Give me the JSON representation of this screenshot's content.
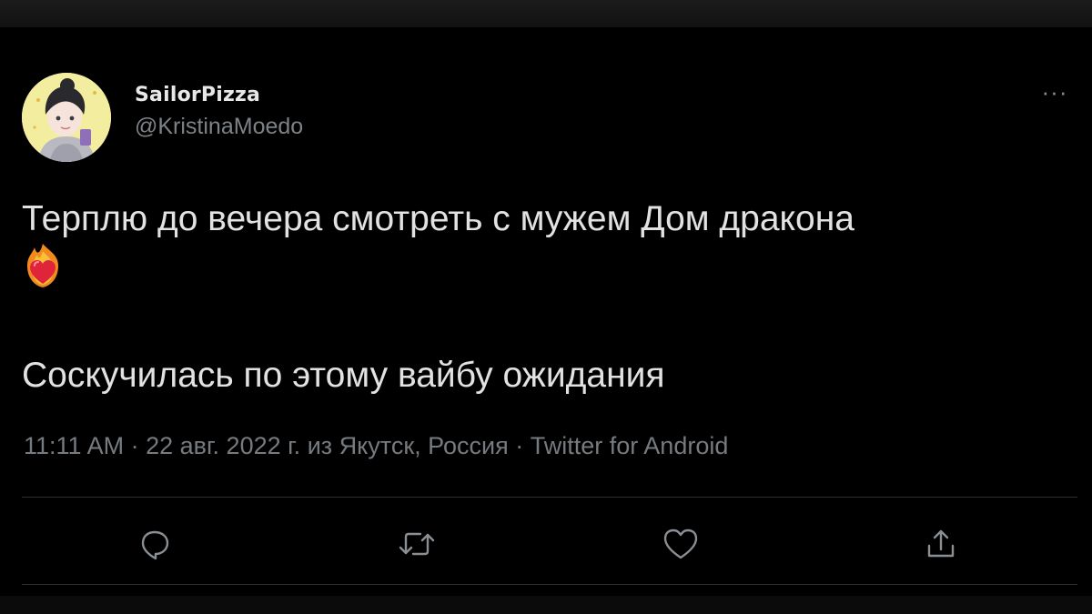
{
  "user": {
    "display_name": "SailorPizza",
    "handle": "@KristinaMoedo"
  },
  "tweet": {
    "line1": "Терплю до вечера смотреть с мужем Дом дракона",
    "emoji": "heart-on-fire-emoji",
    "line2": "Соскучилась по этому вайбу ожидания"
  },
  "meta": {
    "time": "11:11 AM",
    "date": "22 авг. 2022 г.",
    "location_prefix": "из",
    "location": "Якутск, Россия",
    "source": "Twitter for Android",
    "separator": "·"
  },
  "more_label": "···",
  "actions": {
    "reply_icon": "reply-icon",
    "retweet_icon": "retweet-icon",
    "like_icon": "heart-icon",
    "share_icon": "share-icon"
  },
  "colors": {
    "background": "#000000",
    "text": "#e2e2e2",
    "muted": "#767b80",
    "divider": "#2c2f33"
  }
}
